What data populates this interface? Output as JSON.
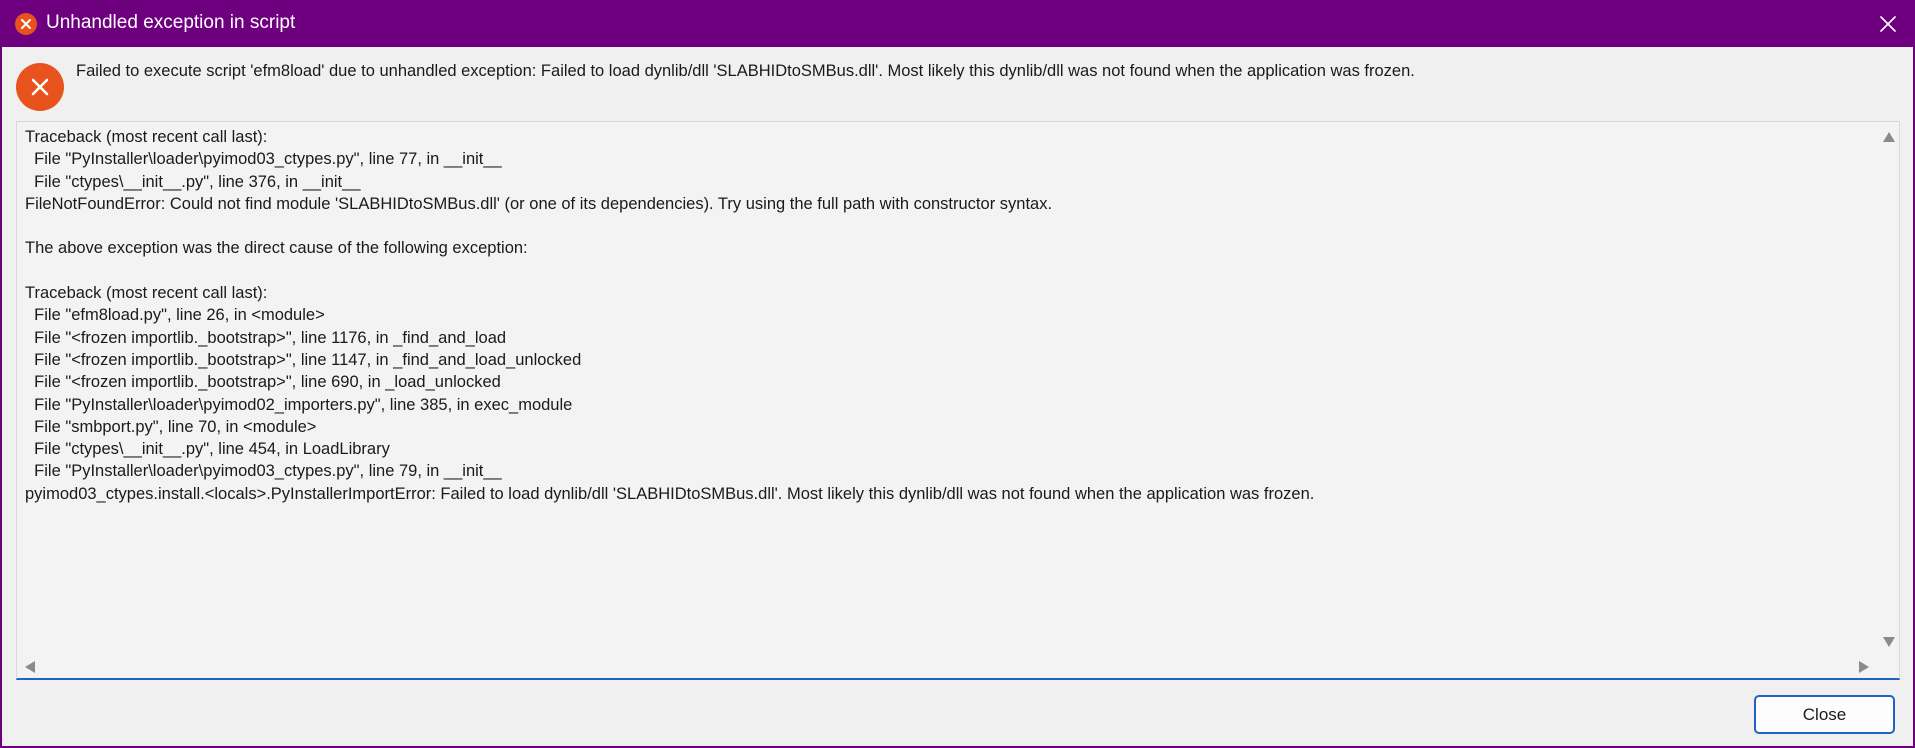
{
  "window": {
    "title": "Unhandled exception in script",
    "title_icon": "error-icon",
    "close_icon": "close-icon",
    "accent_color": "#6e0080",
    "error_color": "#e8521c"
  },
  "message": {
    "text": "Failed to execute script 'efm8load' due to unhandled exception: Failed to load dynlib/dll 'SLABHIDtoSMBus.dll'. Most likely this dynlib/dll was not found when the application was frozen."
  },
  "details": {
    "lines": [
      "Traceback (most recent call last):",
      "  File \"PyInstaller\\loader\\pyimod03_ctypes.py\", line 77, in __init__",
      "  File \"ctypes\\__init__.py\", line 376, in __init__",
      "FileNotFoundError: Could not find module 'SLABHIDtoSMBus.dll' (or one of its dependencies). Try using the full path with constructor syntax.",
      "",
      "The above exception was the direct cause of the following exception:",
      "",
      "Traceback (most recent call last):",
      "  File \"efm8load.py\", line 26, in <module>",
      "  File \"<frozen importlib._bootstrap>\", line 1176, in _find_and_load",
      "  File \"<frozen importlib._bootstrap>\", line 1147, in _find_and_load_unlocked",
      "  File \"<frozen importlib._bootstrap>\", line 690, in _load_unlocked",
      "  File \"PyInstaller\\loader\\pyimod02_importers.py\", line 385, in exec_module",
      "  File \"smbport.py\", line 70, in <module>",
      "  File \"ctypes\\__init__.py\", line 454, in LoadLibrary",
      "  File \"PyInstaller\\loader\\pyimod03_ctypes.py\", line 79, in __init__",
      "pyimod03_ctypes.install.<locals>.PyInstallerImportError: Failed to load dynlib/dll 'SLABHIDtoSMBus.dll'. Most likely this dynlib/dll was not found when the application was frozen."
    ]
  },
  "buttons": {
    "close_label": "Close"
  }
}
